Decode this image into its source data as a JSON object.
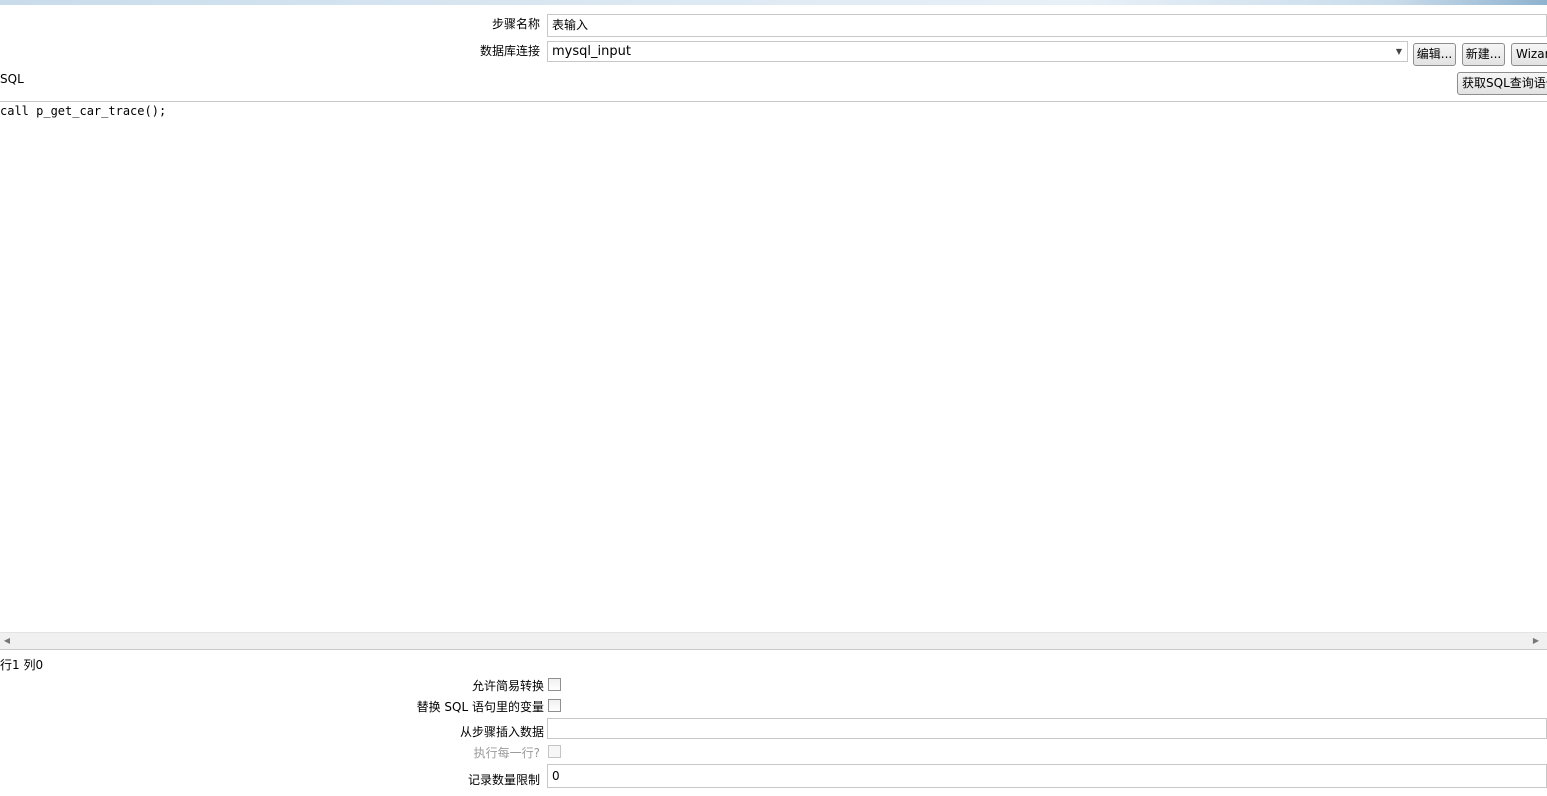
{
  "form": {
    "step_name_label": "步骤名称",
    "step_name_value": "表输入",
    "db_connection_label": "数据库连接",
    "db_connection_value": "mysql_input",
    "edit_button": "编辑...",
    "new_button": "新建...",
    "wizard_button": "Wizard...",
    "sql_label": "SQL",
    "get_sql_button": "获取SQL查询语句..."
  },
  "editor": {
    "content": "call p_get_car_trace();",
    "cursor_position": "行1 列0"
  },
  "options": {
    "lazy_conversion_label": "允许简易转换",
    "replace_variables_label": "替换 SQL 语句里的变量",
    "insert_from_step_label": "从步骤插入数据",
    "insert_from_step_value": "",
    "execute_each_row_label": "执行每一行?",
    "limit_label": "记录数量限制",
    "limit_value": "0"
  },
  "icons": {
    "combo_arrow": "chevron-down-icon",
    "scroll_left": "arrow-left-icon",
    "scroll_right": "arrow-right-icon"
  }
}
